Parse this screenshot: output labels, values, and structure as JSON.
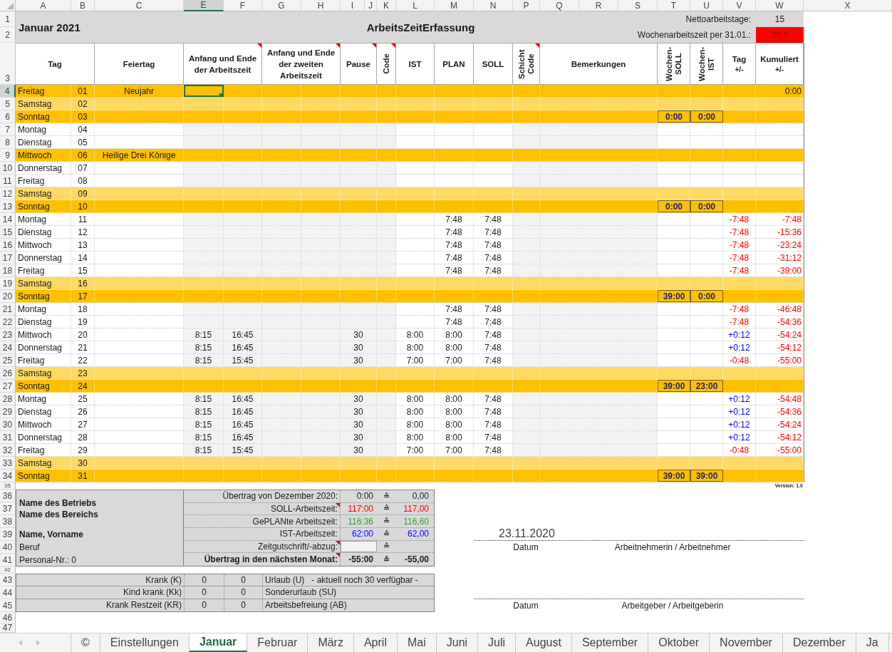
{
  "columns": [
    {
      "label": "A",
      "selected": false
    },
    {
      "label": "B",
      "selected": false
    },
    {
      "label": "C",
      "selected": false
    },
    {
      "label": "E",
      "selected": true
    },
    {
      "label": "F",
      "selected": false
    },
    {
      "label": "G",
      "selected": false
    },
    {
      "label": "H",
      "selected": false
    },
    {
      "label": "I",
      "selected": false
    },
    {
      "label": "J",
      "selected": false
    },
    {
      "label": "K",
      "selected": false
    },
    {
      "label": "L",
      "selected": false
    },
    {
      "label": "M",
      "selected": false
    },
    {
      "label": "N",
      "selected": false
    },
    {
      "label": "P",
      "selected": false
    },
    {
      "label": "Q",
      "selected": false
    },
    {
      "label": "R",
      "selected": false
    },
    {
      "label": "S",
      "selected": false
    },
    {
      "label": "T",
      "selected": false
    },
    {
      "label": "U",
      "selected": false
    },
    {
      "label": "V",
      "selected": false
    },
    {
      "label": "W",
      "selected": false
    },
    {
      "label": "X",
      "selected": false
    }
  ],
  "title": {
    "rows": [
      {
        "label": "1",
        "selected": false
      },
      {
        "label": "2",
        "selected": false
      }
    ],
    "month": "Januar 2021",
    "heading": "ArbeitsZeitErfassung",
    "net_days_label": "Nettoarbeitstage:",
    "net_days": "15",
    "weekly_hours_label": "Wochenarbeitszeit per 31.01.:",
    "weekly_hours": "39,0",
    "weekly_hours_alert": true
  },
  "header": {
    "row": {
      "label": "3",
      "selected": false
    },
    "cells": [
      {
        "label": "Tag",
        "kind": "horizontal",
        "comment": false
      },
      {
        "label": "Feiertag",
        "kind": "horizontal",
        "comment": false
      },
      {
        "label": "Anfang und Ende der Arbeitszeit",
        "kind": "horizontal",
        "comment": true
      },
      {
        "label": "Anfang und Ende der zweiten Arbeitszeit",
        "kind": "horizontal",
        "comment": true
      },
      {
        "label": "Pause",
        "kind": "horizontal",
        "comment": true
      },
      {
        "label": "Code",
        "kind": "vertical",
        "comment": true
      },
      {
        "label": "IST",
        "kind": "horizontal",
        "comment": false
      },
      {
        "label": "PLAN",
        "kind": "horizontal",
        "comment": false
      },
      {
        "label": "SOLL",
        "kind": "horizontal",
        "comment": false
      },
      {
        "label": "Schicht Code",
        "kind": "vertical",
        "comment": true
      },
      {
        "label": "Bemerkungen",
        "kind": "horizontal",
        "comment": false
      },
      {
        "label": "Wochen-SOLL",
        "kind": "vertical",
        "comment": false
      },
      {
        "label": "Wochen-IST",
        "kind": "vertical",
        "comment": false
      },
      {
        "label": "Tag",
        "sub": "+/-",
        "kind": "horizontal",
        "comment": false
      },
      {
        "label": "Kumuliert",
        "sub": "+/-",
        "kind": "horizontal",
        "comment": false
      }
    ]
  },
  "days": [
    {
      "row": "4",
      "selected": true,
      "kind": "holiday",
      "day": "Freitag",
      "date": "01",
      "holiday": "Neujahr",
      "cum": {
        "text": "0:00"
      }
    },
    {
      "row": "5",
      "selected": false,
      "kind": "saturday",
      "day": "Samstag",
      "date": "02"
    },
    {
      "row": "6",
      "selected": false,
      "kind": "sunday",
      "day": "Sonntag",
      "date": "03",
      "week_soll": "0:00",
      "week_ist": "0:00"
    },
    {
      "row": "7",
      "selected": false,
      "kind": "workday",
      "day": "Montag",
      "date": "04"
    },
    {
      "row": "8",
      "selected": false,
      "kind": "workday",
      "day": "Dienstag",
      "date": "05"
    },
    {
      "row": "9",
      "selected": false,
      "kind": "holiday",
      "day": "Mittwoch",
      "date": "06",
      "holiday": "Heilige Drei Könige"
    },
    {
      "row": "10",
      "selected": false,
      "kind": "workday",
      "day": "Donnerstag",
      "date": "07"
    },
    {
      "row": "11",
      "selected": false,
      "kind": "workday",
      "day": "Freitag",
      "date": "08"
    },
    {
      "row": "12",
      "selected": false,
      "kind": "saturday",
      "day": "Samstag",
      "date": "09"
    },
    {
      "row": "13",
      "selected": false,
      "kind": "sunday",
      "day": "Sonntag",
      "date": "10",
      "week_soll": "0:00",
      "week_ist": "0:00"
    },
    {
      "row": "14",
      "selected": false,
      "kind": "workday",
      "day": "Montag",
      "date": "11",
      "plan": "7:48",
      "soll": "7:48",
      "diff": {
        "text": "-7:48",
        "color": "#ff0000"
      },
      "cum": {
        "text": "-7:48",
        "color": "#ff0000"
      }
    },
    {
      "row": "15",
      "selected": false,
      "kind": "workday",
      "day": "Dienstag",
      "date": "12",
      "plan": "7:48",
      "soll": "7:48",
      "diff": {
        "text": "-7:48",
        "color": "#ff0000"
      },
      "cum": {
        "text": "-15:36",
        "color": "#ff0000"
      }
    },
    {
      "row": "16",
      "selected": false,
      "kind": "workday",
      "day": "Mittwoch",
      "date": "13",
      "plan": "7:48",
      "soll": "7:48",
      "diff": {
        "text": "-7:48",
        "color": "#ff0000"
      },
      "cum": {
        "text": "-23:24",
        "color": "#ff0000"
      }
    },
    {
      "row": "17",
      "selected": false,
      "kind": "workday",
      "day": "Donnerstag",
      "date": "14",
      "plan": "7:48",
      "soll": "7:48",
      "diff": {
        "text": "-7:48",
        "color": "#ff0000"
      },
      "cum": {
        "text": "-31:12",
        "color": "#ff0000"
      }
    },
    {
      "row": "18",
      "selected": false,
      "kind": "workday",
      "day": "Freitag",
      "date": "15",
      "plan": "7:48",
      "soll": "7:48",
      "diff": {
        "text": "-7:48",
        "color": "#ff0000"
      },
      "cum": {
        "text": "-39:00",
        "color": "#ff0000"
      }
    },
    {
      "row": "19",
      "selected": false,
      "kind": "saturday",
      "day": "Samstag",
      "date": "16"
    },
    {
      "row": "20",
      "selected": false,
      "kind": "sunday",
      "day": "Sonntag",
      "date": "17",
      "week_soll": "39:00",
      "week_ist": "0:00"
    },
    {
      "row": "21",
      "selected": false,
      "kind": "workday",
      "day": "Montag",
      "date": "18",
      "plan": "7:48",
      "soll": "7:48",
      "diff": {
        "text": "-7:48",
        "color": "#ff0000"
      },
      "cum": {
        "text": "-46:48",
        "color": "#ff0000"
      }
    },
    {
      "row": "22",
      "selected": false,
      "kind": "workday",
      "day": "Dienstag",
      "date": "19",
      "plan": "7:48",
      "soll": "7:48",
      "diff": {
        "text": "-7:48",
        "color": "#ff0000"
      },
      "cum": {
        "text": "-54:36",
        "color": "#ff0000"
      }
    },
    {
      "row": "23",
      "selected": false,
      "kind": "workday",
      "day": "Mittwoch",
      "date": "20",
      "start": "8:15",
      "end": "16:45",
      "pause": "30",
      "ist": "8:00",
      "plan": "8:00",
      "soll": "7:48",
      "diff": {
        "text": "+0:12",
        "color": "#0000ff"
      },
      "cum": {
        "text": "-54:24",
        "color": "#ff0000"
      }
    },
    {
      "row": "24",
      "selected": false,
      "kind": "workday",
      "day": "Donnerstag",
      "date": "21",
      "start": "8:15",
      "end": "16:45",
      "pause": "30",
      "ist": "8:00",
      "plan": "8:00",
      "soll": "7:48",
      "diff": {
        "text": "+0:12",
        "color": "#0000ff"
      },
      "cum": {
        "text": "-54:12",
        "color": "#ff0000"
      }
    },
    {
      "row": "25",
      "selected": false,
      "kind": "workday",
      "day": "Freitag",
      "date": "22",
      "start": "8:15",
      "end": "15:45",
      "pause": "30",
      "ist": "7:00",
      "plan": "7:00",
      "soll": "7:48",
      "diff": {
        "text": "-0:48",
        "color": "#ff0000"
      },
      "cum": {
        "text": "-55:00",
        "color": "#ff0000"
      }
    },
    {
      "row": "26",
      "selected": false,
      "kind": "saturday",
      "day": "Samstag",
      "date": "23"
    },
    {
      "row": "27",
      "selected": false,
      "kind": "sunday",
      "day": "Sonntag",
      "date": "24",
      "week_soll": "39:00",
      "week_ist": "23:00"
    },
    {
      "row": "28",
      "selected": false,
      "kind": "workday",
      "day": "Montag",
      "date": "25",
      "start": "8:15",
      "end": "16:45",
      "pause": "30",
      "ist": "8:00",
      "plan": "8:00",
      "soll": "7:48",
      "diff": {
        "text": "+0:12",
        "color": "#0000ff"
      },
      "cum": {
        "text": "-54:48",
        "color": "#ff0000"
      }
    },
    {
      "row": "29",
      "selected": false,
      "kind": "workday",
      "day": "Dienstag",
      "date": "26",
      "start": "8:15",
      "end": "16:45",
      "pause": "30",
      "ist": "8:00",
      "plan": "8:00",
      "soll": "7:48",
      "diff": {
        "text": "+0:12",
        "color": "#0000ff"
      },
      "cum": {
        "text": "-54:36",
        "color": "#ff0000"
      }
    },
    {
      "row": "30",
      "selected": false,
      "kind": "workday",
      "day": "Mittwoch",
      "date": "27",
      "start": "8:15",
      "end": "16:45",
      "pause": "30",
      "ist": "8:00",
      "plan": "8:00",
      "soll": "7:48",
      "diff": {
        "text": "+0:12",
        "color": "#0000ff"
      },
      "cum": {
        "text": "-54:24",
        "color": "#ff0000"
      }
    },
    {
      "row": "31",
      "selected": false,
      "kind": "workday",
      "day": "Donnerstag",
      "date": "28",
      "start": "8:15",
      "end": "16:45",
      "pause": "30",
      "ist": "8:00",
      "plan": "8:00",
      "soll": "7:48",
      "diff": {
        "text": "+0:12",
        "color": "#0000ff"
      },
      "cum": {
        "text": "-54:12",
        "color": "#ff0000"
      }
    },
    {
      "row": "32",
      "selected": false,
      "kind": "workday",
      "day": "Freitag",
      "date": "29",
      "start": "8:15",
      "end": "15:45",
      "pause": "30",
      "ist": "7:00",
      "plan": "7:00",
      "soll": "7:48",
      "diff": {
        "text": "-0:48",
        "color": "#ff0000"
      },
      "cum": {
        "text": "-55:00",
        "color": "#ff0000"
      }
    },
    {
      "row": "33",
      "selected": false,
      "kind": "saturday",
      "day": "Samstag",
      "date": "30"
    },
    {
      "row": "34",
      "selected": false,
      "kind": "sunday",
      "day": "Sonntag",
      "date": "31",
      "week_soll": "39:00",
      "week_ist": "39:00"
    }
  ],
  "footer_rows": [
    {
      "label": "35",
      "selected": false
    },
    {
      "label": "36",
      "selected": false
    },
    {
      "label": "37",
      "selected": false
    },
    {
      "label": "38",
      "selected": false
    },
    {
      "label": "39",
      "selected": false
    },
    {
      "label": "40",
      "selected": false
    },
    {
      "label": "41",
      "selected": false
    },
    {
      "label": "42",
      "selected": false
    },
    {
      "label": "43",
      "selected": false
    },
    {
      "label": "44",
      "selected": false
    },
    {
      "label": "45",
      "selected": false
    },
    {
      "label": "46",
      "selected": false
    },
    {
      "label": "47",
      "selected": false
    }
  ],
  "version": "Version: 1.0",
  "info": {
    "lines": [
      {
        "text": "Name des Betriebs",
        "bold": true
      },
      {
        "text": "Name des Bereichs",
        "bold": true
      },
      {
        "text": "Name, Vorname",
        "bold": true
      },
      {
        "text": "Beruf",
        "bold": false
      },
      {
        "text": "Personal-Nr.: 0",
        "bold": false
      }
    ]
  },
  "summary": [
    {
      "kind": "value",
      "label": "Übertrag von Dezember 2020:",
      "hours": "0:00",
      "equiv": "≙",
      "decimal": "0,00",
      "bold": false,
      "comment": false
    },
    {
      "kind": "value",
      "label": "SOLL-Arbeitszeit:",
      "hours": "117:00",
      "equiv": "≙",
      "decimal": "117,00",
      "color": "#ff0000",
      "bold": false,
      "comment": true
    },
    {
      "kind": "value",
      "label": "GePLANte Arbeitszeit:",
      "hours": "116:36",
      "equiv": "≙",
      "decimal": "116,60",
      "color": "#2e9e2e",
      "bold": false,
      "comment": false
    },
    {
      "kind": "value",
      "label": "IST-Arbeitszeit:",
      "hours": "62:00",
      "equiv": "≙",
      "decimal": "62,00",
      "color": "#0000ff",
      "bold": false,
      "comment": false
    },
    {
      "kind": "input",
      "label": "Zeitgutschrift/-abzug:",
      "equiv": "≙",
      "bold": false,
      "comment": true
    },
    {
      "kind": "value",
      "label": "Übertrag in den nächsten Monat:",
      "hours": "-55:00",
      "equiv": "≙",
      "decimal": "-55,00",
      "bold": true,
      "comment": true
    }
  ],
  "absences": [
    {
      "label": "Krank (K)",
      "values": [
        "0",
        "0"
      ],
      "leave": "Urlaub (U)",
      "note": "- aktuell noch 30 verfügbar -"
    },
    {
      "label": "Kind krank (Kk)",
      "values": [
        "0",
        "0"
      ],
      "leave": "Sonderurlaub (SU)"
    },
    {
      "label": "Krank Restzeit (KR)",
      "values": [
        "0",
        "0"
      ],
      "leave": "Arbeitsbefreiung (AB)"
    }
  ],
  "signature": {
    "lines": [
      {
        "value": "23.11.2020",
        "date_label": "Datum",
        "role": "Arbeitnehmerin / Arbeitnehmer"
      },
      {
        "date_label": "Datum",
        "role": "Arbeitgeber / Arbeitgeberin"
      }
    ]
  },
  "sheet_tabs": [
    {
      "label": "©",
      "selected": false
    },
    {
      "label": "Einstellungen",
      "selected": false
    },
    {
      "label": "Januar",
      "selected": true
    },
    {
      "label": "Februar",
      "selected": false
    },
    {
      "label": "März",
      "selected": false
    },
    {
      "label": "April",
      "selected": false
    },
    {
      "label": "Mai",
      "selected": false
    },
    {
      "label": "Juni",
      "selected": false
    },
    {
      "label": "Juli",
      "selected": false
    },
    {
      "label": "August",
      "selected": false
    },
    {
      "label": "September",
      "selected": false
    },
    {
      "label": "Oktober",
      "selected": false
    },
    {
      "label": "November",
      "selected": false
    },
    {
      "label": "Dezember",
      "selected": false
    },
    {
      "label": "Ja",
      "selected": false
    }
  ]
}
